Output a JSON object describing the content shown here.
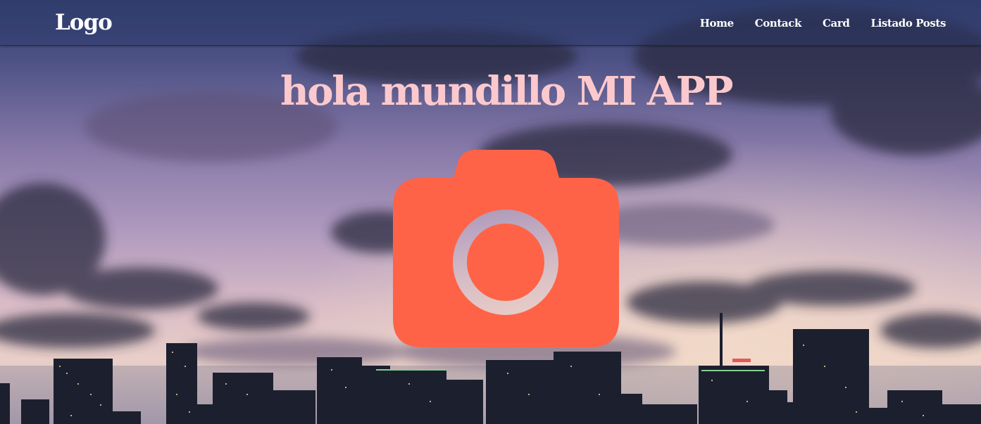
{
  "nav": {
    "logo": "Logo",
    "links": [
      {
        "label": "Home"
      },
      {
        "label": "Contack"
      },
      {
        "label": "Card"
      },
      {
        "label": "Listado Posts"
      }
    ]
  },
  "hero": {
    "title": "hola mundillo MI APP",
    "image_icon": "camera-icon",
    "background": "city-skyline-at-dusk"
  },
  "colors": {
    "title": "#fbc9cd",
    "camera": "#ff6347",
    "nav_text": "#ffffff"
  }
}
